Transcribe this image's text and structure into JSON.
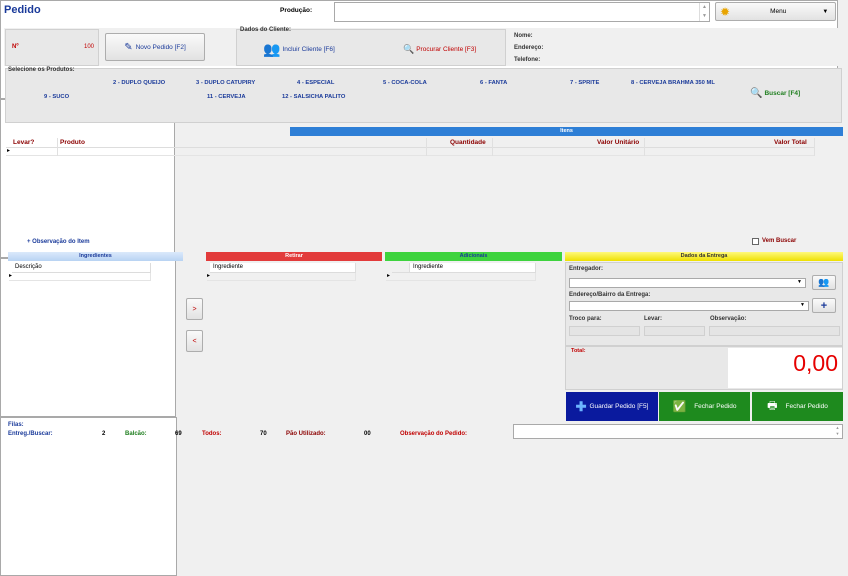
{
  "header": {
    "title": "Pedido",
    "producao_label": "Produção:",
    "menu_label": "Menu"
  },
  "order": {
    "number_label": "Nº",
    "number_value": "100",
    "new_order_label": "Novo Pedido [F2]"
  },
  "cliente": {
    "title": "Dados do Cliente:",
    "include_label": "Incluir Cliente [F6]",
    "search_label": "Procurar Cliente [F3]",
    "nome_label": "Nome:",
    "endereco_label": "Endereço:",
    "telefone_label": "Telefone:"
  },
  "produtos": {
    "title": "Selecione os Produtos:",
    "items": [
      "2 - DUPLO QUEIJO",
      "3 - DUPLO CATUPIRY",
      "4 - ESPECIAL",
      "5 - COCA-COLA",
      "6 - FANTA",
      "7 - SPRITE",
      "8 - CERVEJA BRAHMA 350 ML",
      "9 - SUCO",
      "11 - CERVEJA",
      "12 - SALSICHA PALITO"
    ],
    "search_label": "Buscar [F4]"
  },
  "itens": {
    "title": "Itens",
    "columns": [
      "Levar?",
      "Produto",
      "Quantidade",
      "Valor Unitário",
      "Valor Total"
    ],
    "obs_item_label": "+ Observação do Item",
    "vem_buscar_label": "Vem Buscar"
  },
  "ingredientes": {
    "title": "Ingredientes",
    "column": "Descrição"
  },
  "retirar": {
    "title": "Retirar",
    "column": "Ingrediente"
  },
  "adicionais": {
    "title": "Adicionais",
    "column": "Ingrediente"
  },
  "arrows": {
    "right": ">",
    "left": "<"
  },
  "entrega": {
    "title": "Dados da Entrega",
    "entregador_label": "Entregador:",
    "endereco_label": "Endereço/Bairro da Entrega:",
    "troco_label": "Troco para:",
    "levar_label": "Levar:",
    "observacao_label": "Observação:",
    "total_label": "Total:",
    "total_value": "0,00"
  },
  "actions": {
    "guardar": "Guardar Pedido [F5]",
    "fechar1": "Fechar Pedido",
    "fechar2": "Fechar Pedido"
  },
  "footer": {
    "filas_label": "Filas:",
    "entreg_label": "Entreg./Buscar:",
    "entreg_value": "2",
    "balcao_label": "Balcão:",
    "balcao_value": "69",
    "todos_label": "Todos:",
    "todos_value": "70",
    "pao_label": "Pão Utilizado:",
    "pao_value": "00",
    "obs_pedido_label": "Observação do Pedido:"
  },
  "colors": {
    "accent": "#1a3a9a",
    "red": "#c00000",
    "green": "#1e7e1e",
    "itens_header": "#2e7fd6"
  }
}
